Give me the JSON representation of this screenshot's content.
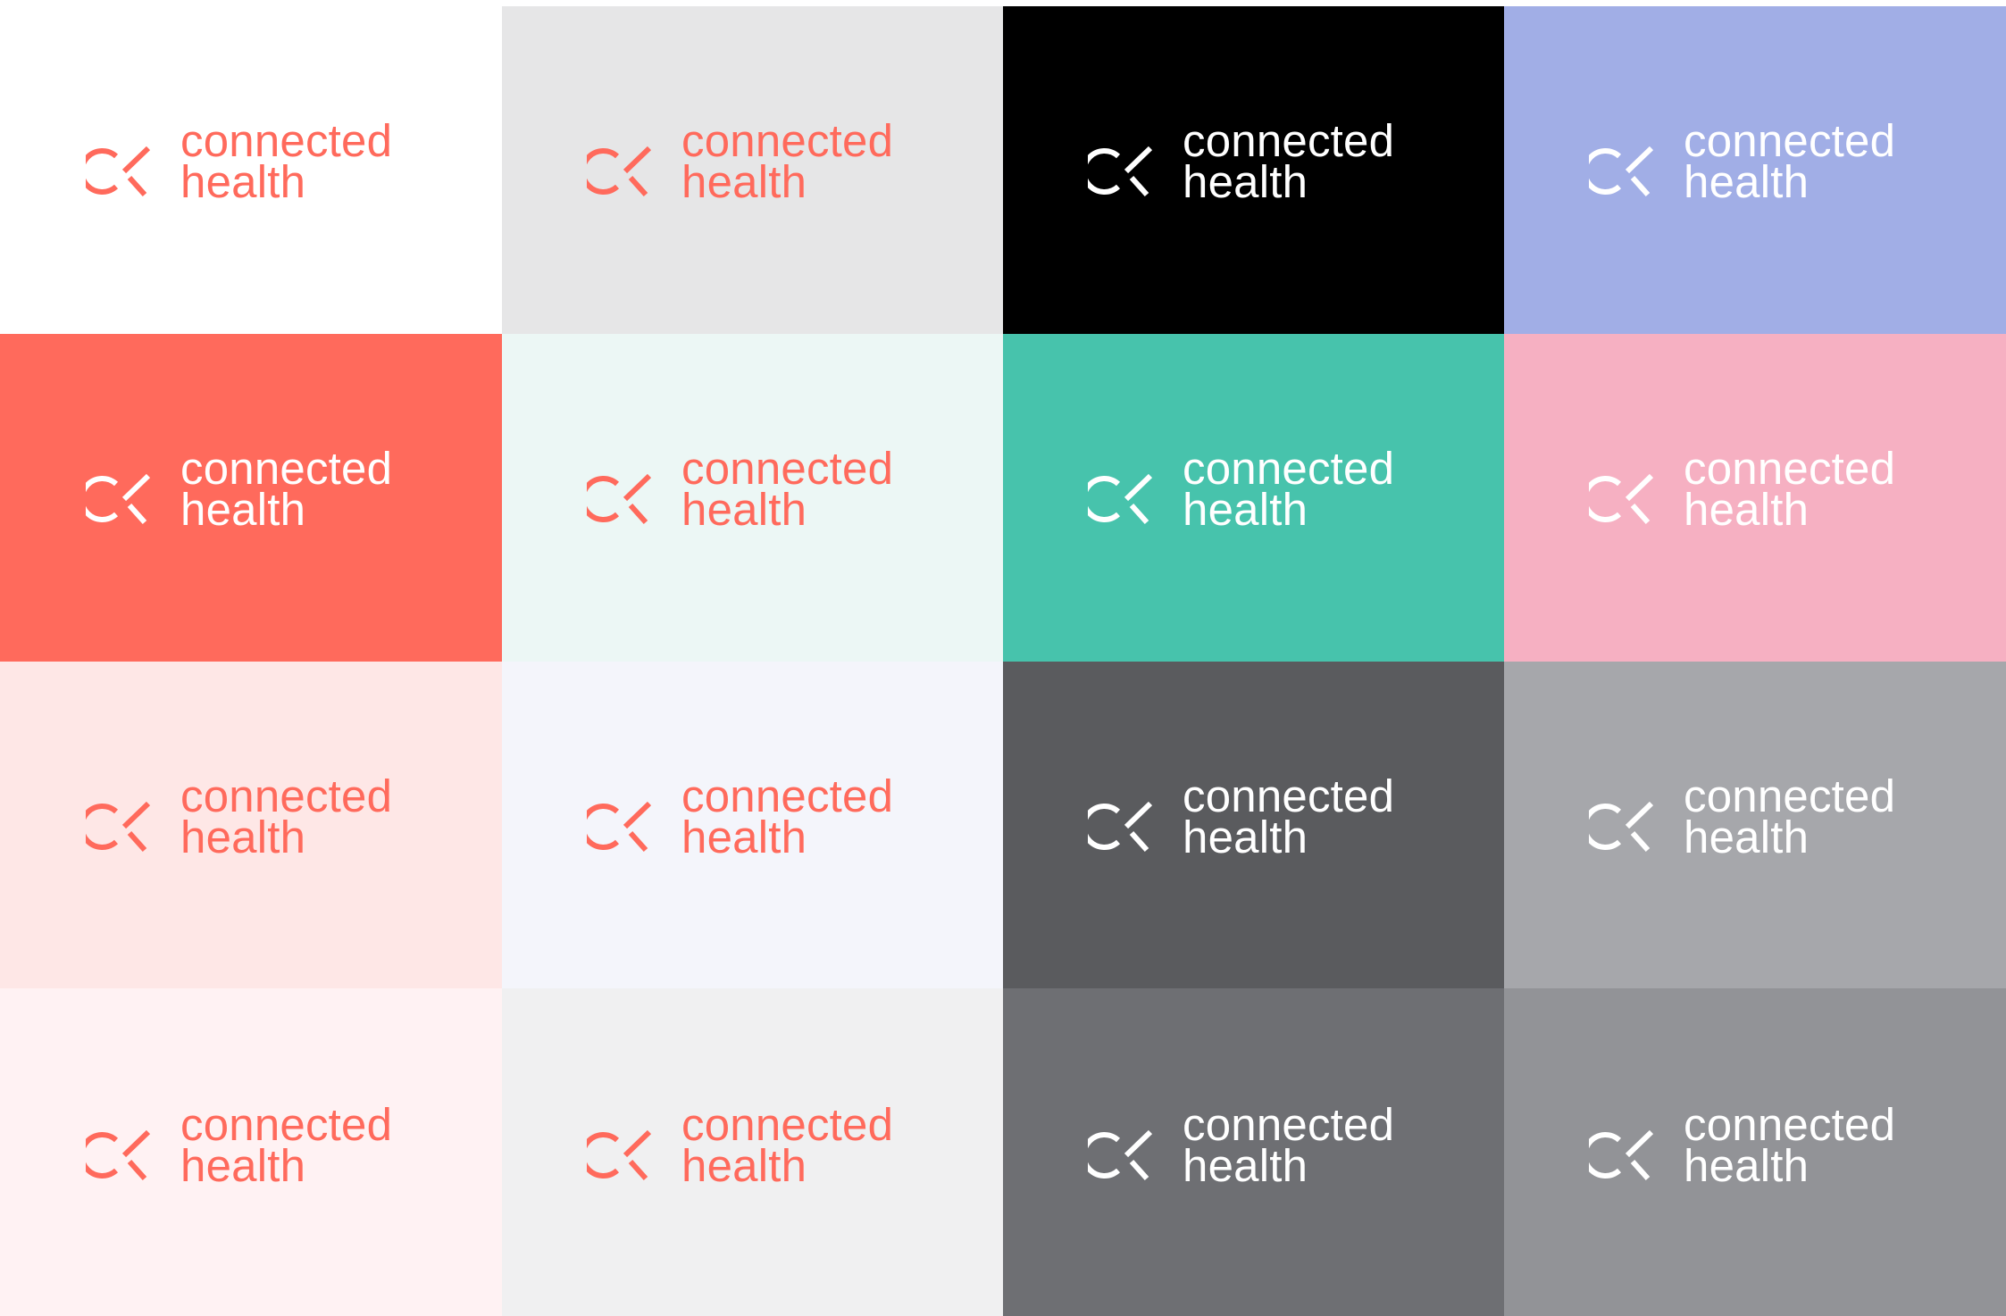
{
  "logo": {
    "line1": "connected",
    "line2": "health",
    "icon": "infinity-x-icon"
  },
  "colors": {
    "coral": "#FF6A5C",
    "white": "#FFFFFF"
  },
  "tiles": [
    {
      "bg": "#FFFFFF",
      "fg": "#FF6A5C"
    },
    {
      "bg": "#E6E6E7",
      "fg": "#FF6A5C"
    },
    {
      "bg": "#000000",
      "fg": "#FFFFFF"
    },
    {
      "bg": "#A1AEE6",
      "fg": "#FFFFFF"
    },
    {
      "bg": "#FF6A5C",
      "fg": "#FFFFFF"
    },
    {
      "bg": "#ECF7F5",
      "fg": "#FF6A5C"
    },
    {
      "bg": "#47C3AC",
      "fg": "#FFFFFF"
    },
    {
      "bg": "#F6B0C2",
      "fg": "#FFFFFF"
    },
    {
      "bg": "#FEE7E6",
      "fg": "#FF6A5C"
    },
    {
      "bg": "#F4F5FB",
      "fg": "#FF6A5C"
    },
    {
      "bg": "#5A5B5E",
      "fg": "#FFFFFF"
    },
    {
      "bg": "#A6A7AB",
      "fg": "#FFFFFF"
    },
    {
      "bg": "#FFF2F3",
      "fg": "#FF6A5C"
    },
    {
      "bg": "#F0F0F1",
      "fg": "#FF6A5C"
    },
    {
      "bg": "#6E6F73",
      "fg": "#FFFFFF"
    },
    {
      "bg": "#929397",
      "fg": "#FFFFFF"
    }
  ]
}
